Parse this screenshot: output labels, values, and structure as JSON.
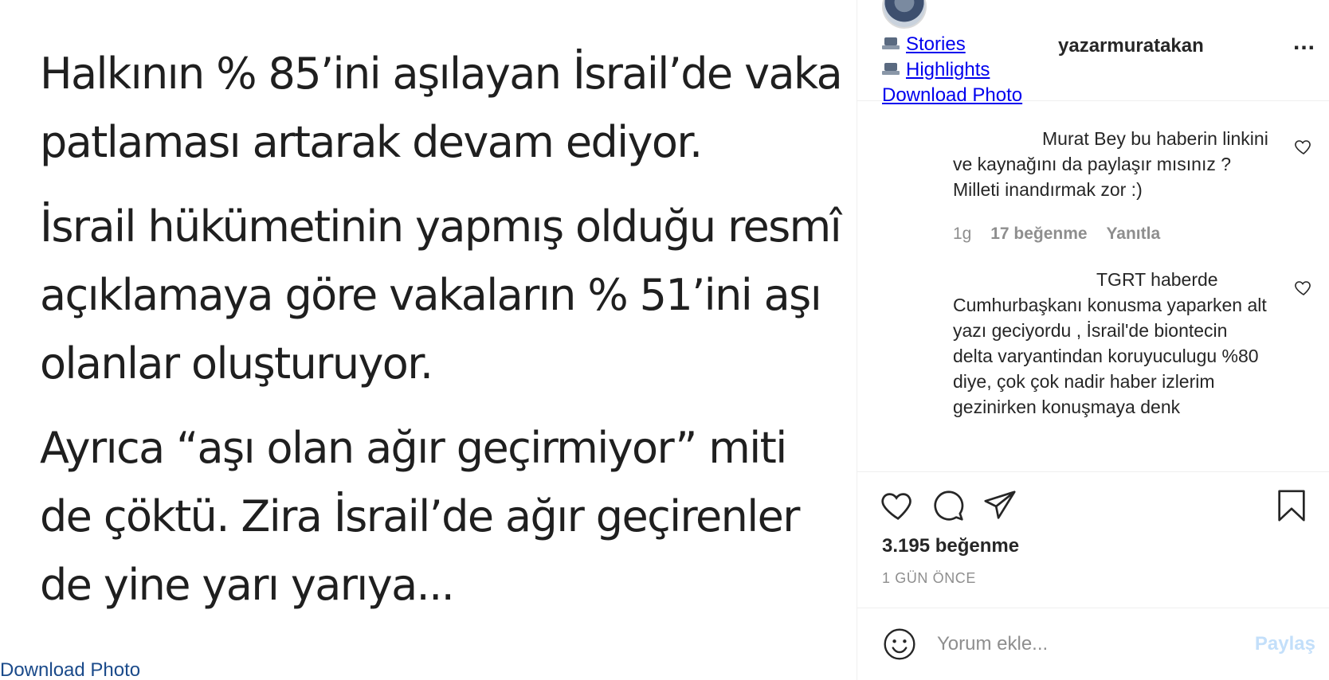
{
  "post": {
    "paragraphs": [
      "Halkının % 85’ini aşılayan İsrail’de vaka patlaması artarak devam ediyor.",
      "İsrail hükümetinin yapmış olduğu resmî açıklamaya göre vakaların % 51’ini aşı olanlar oluşturuyor.",
      "Ayrıca “aşı olan ağır geçirmiyor” miti de çöktü. Zira İsrail’de ağır geçirenler de yine yarı yarıya..."
    ],
    "download_label": "Download Photo"
  },
  "header": {
    "stories_label": "Stories",
    "highlights_label": "Highlights",
    "download_label": "Download Photo",
    "username": "yazarmuratakan",
    "more_label": "..."
  },
  "comments": [
    {
      "text": "Murat Bey bu haberin linkini ve kaynağını da paylaşır mısınız ? Milleti inandırmak zor :)",
      "time": "1g",
      "likes": "17 beğenme",
      "reply": "Yanıtla"
    },
    {
      "text": "TGRT haberde Cumhurbaşkanı konusma yaparken alt yazı geciyordu , İsrail'de biontecin delta varyantindan koruyuculugu %80 diye, çok çok nadir haber izlerim gezinirken konuşmaya denk"
    }
  ],
  "actions": {
    "likes": "3.195 beğenme",
    "time_ago": "1 GÜN ÖNCE"
  },
  "add_comment": {
    "placeholder": "Yorum ekle...",
    "post_label": "Paylaş"
  },
  "colors": {
    "link": "#1a4a8a",
    "muted": "#8e8e8e",
    "text": "#262626",
    "border": "#efefef",
    "post_disabled": "#c3dffa"
  },
  "icons": [
    "heart-icon",
    "comment-icon",
    "share-icon",
    "bookmark-icon",
    "smiley-icon",
    "more-icon",
    "heart-small-icon",
    "stories-icon",
    "highlights-icon"
  ]
}
